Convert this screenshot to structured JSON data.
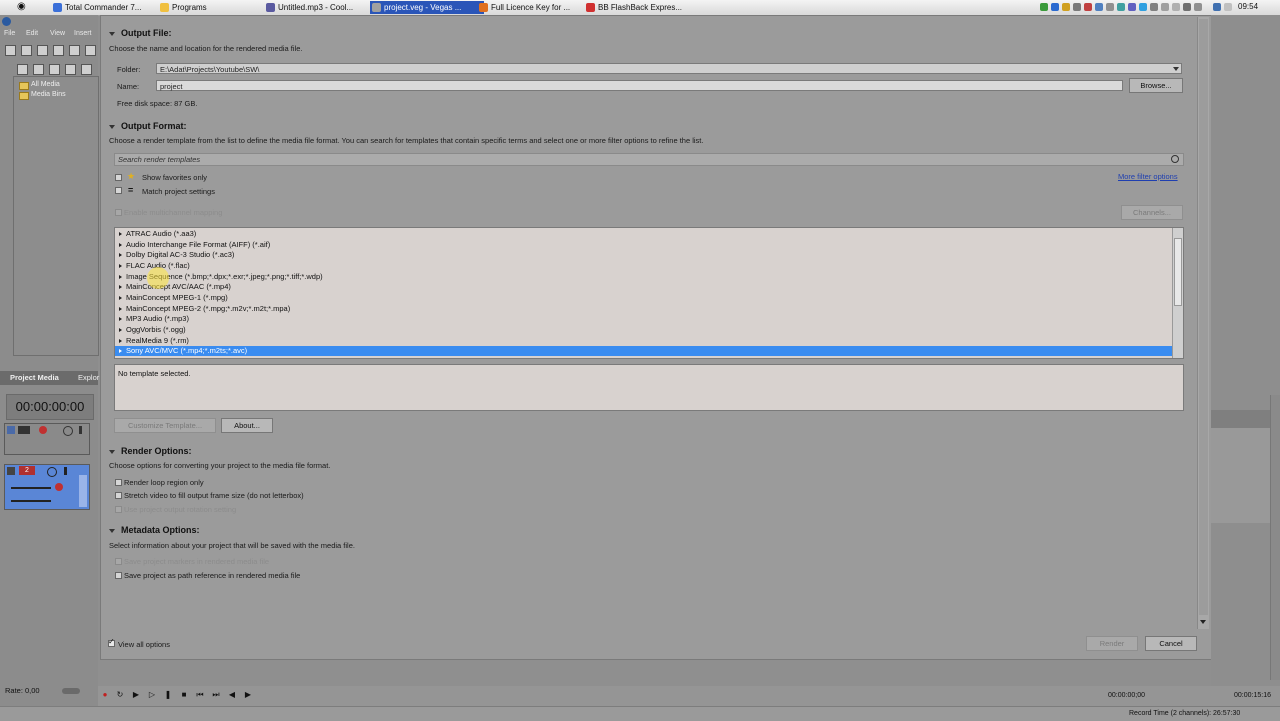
{
  "taskbar": {
    "tasks": [
      {
        "label": "Total Commander 7...",
        "icon_color": "#3a6fd8"
      },
      {
        "label": "Programs",
        "icon_color": "#f0c040"
      },
      {
        "label": "Untitled.mp3 - Cool...",
        "icon_color": "#5a5aa0"
      },
      {
        "label": "project.veg - Vegas ...",
        "icon_color": "#a0a0a0"
      },
      {
        "label": "Full Licence Key for ...",
        "icon_color": "#e07020"
      },
      {
        "label": "BB FlashBack Expres...",
        "icon_color": "#d03030"
      }
    ],
    "active_task_index": 3,
    "clock": "09:54"
  },
  "leftpane": {
    "menu": [
      "File",
      "Edit",
      "View",
      "Insert"
    ],
    "tree": [
      "All Media",
      "Media Bins"
    ],
    "tabs": [
      "Project Media",
      "Explor"
    ],
    "timecode": "00:00:00:00",
    "rate": "Rate: 0,00",
    "track_label": "2"
  },
  "dialog": {
    "output_file": {
      "title": "Output File:",
      "desc": "Choose the name and location for the rendered media file.",
      "folder_label": "Folder:",
      "folder_value": "E:\\Adat\\Projects\\Youtube\\SW\\",
      "name_label": "Name:",
      "name_value": "project",
      "browse": "Browse...",
      "free_space": "Free disk space: 87 GB."
    },
    "output_format": {
      "title": "Output Format:",
      "desc": "Choose a render template from the list to define the media file format. You can search for templates that contain specific terms and select one or more filter options to refine the list.",
      "search_placeholder": "Search render templates",
      "show_favorites": "Show favorites only",
      "match_project": "Match project settings",
      "more_filter": "More filter options",
      "multichannel": "Enable multichannel mapping",
      "channels": "Channels...",
      "formats": [
        "ATRAC Audio (*.aa3)",
        "Audio Interchange File Format (AIFF) (*.aif)",
        "Dolby Digital AC-3 Studio (*.ac3)",
        "FLAC Audio (*.flac)",
        "Image Sequence (*.bmp;*.dpx;*.exr;*.jpeg;*.png;*.tiff;*.wdp)",
        "MainConcept AVC/AAC (*.mp4)",
        "MainConcept MPEG-1 (*.mpg)",
        "MainConcept MPEG-2 (*.mpg;*.m2v;*.m2t;*.mpa)",
        "MP3 Audio (*.mp3)",
        "OggVorbis (*.ogg)",
        "RealMedia 9 (*.rm)",
        "Sony AVC/MVC (*.mp4;*.m2ts;*.avc)"
      ],
      "selected_index": 11,
      "no_template": "No template selected.",
      "customize": "Customize Template...",
      "about": "About..."
    },
    "render_options": {
      "title": "Render Options:",
      "desc": "Choose options for converting your project to the media file format.",
      "loop_region": "Render loop region only",
      "stretch_video": "Stretch video to fill output frame size (do not letterbox)",
      "rotation": "Use project output rotation setting"
    },
    "metadata_options": {
      "title": "Metadata Options:",
      "desc": "Select information about your project that will be saved with the media file.",
      "save_markers": "Save project markers in rendered media file",
      "save_path": "Save project as path reference in rendered media file"
    },
    "view_all": "View all options",
    "view_all_checked": true,
    "render": "Render",
    "cancel": "Cancel"
  },
  "transport": {
    "time": "00:00:00;00",
    "end_time": "00:00:15:16"
  },
  "statusbar": {
    "record_time": "Record Time (2 channels): 26:57:30"
  }
}
